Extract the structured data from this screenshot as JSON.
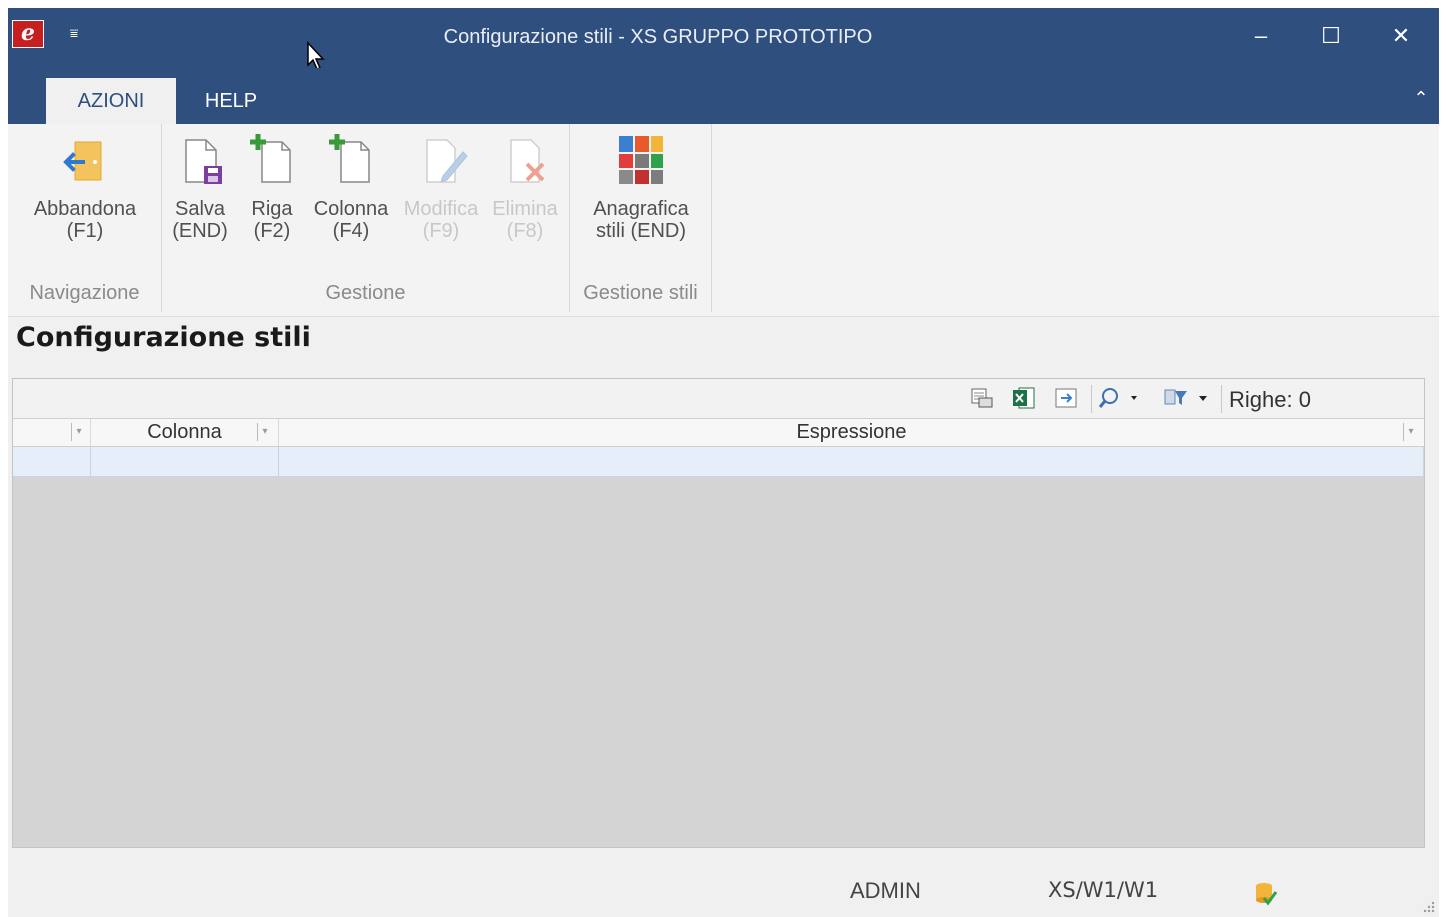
{
  "window": {
    "title": "Configurazione stili - XS  GRUPPO PROTOTIPO",
    "logo_letter": "e",
    "qat_symbol": "⩸",
    "minimize": "–",
    "maximize": "☐",
    "close": "✕"
  },
  "tabs": [
    {
      "label": "AZIONI",
      "active": true
    },
    {
      "label": "HELP",
      "active": false
    }
  ],
  "ribbon": {
    "collapse_symbol": "⌃",
    "groups": {
      "navigazione": {
        "label": "Navigazione",
        "buttons": {
          "abbandona": {
            "line1": "Abbandona",
            "line2": "(F1)",
            "icon": "exit-door-icon"
          }
        }
      },
      "gestione": {
        "label": "Gestione",
        "buttons": {
          "salva": {
            "line1": "Salva",
            "line2": "(END)",
            "icon": "save-document-icon"
          },
          "riga": {
            "line1": "Riga",
            "line2": "(F2)",
            "icon": "add-document-icon"
          },
          "colonna": {
            "line1": "Colonna",
            "line2": "(F4)",
            "icon": "add-document-icon"
          },
          "modifica": {
            "line1": "Modifica",
            "line2": "(F9)",
            "icon": "edit-document-icon",
            "disabled": true
          },
          "elimina": {
            "line1": "Elimina",
            "line2": "(F8)",
            "icon": "delete-document-icon",
            "disabled": true
          }
        }
      },
      "gestione_stili": {
        "label": "Gestione stili",
        "buttons": {
          "anagrafica": {
            "line1": "Anagrafica",
            "line2": "stili (END)",
            "icon": "color-palette-icon"
          }
        }
      }
    }
  },
  "form": {
    "title": "Configurazione stili"
  },
  "grid": {
    "rows_label": "Righe: 0",
    "columns": [
      "",
      "Colonna",
      "Espressione"
    ]
  },
  "status": {
    "user": "ADMIN",
    "path": "XS/W1/W1"
  },
  "colors": {
    "titlebar": "#2f4f7f",
    "new_row": "#e6eff9",
    "grid_background": "#d4d4d4"
  }
}
